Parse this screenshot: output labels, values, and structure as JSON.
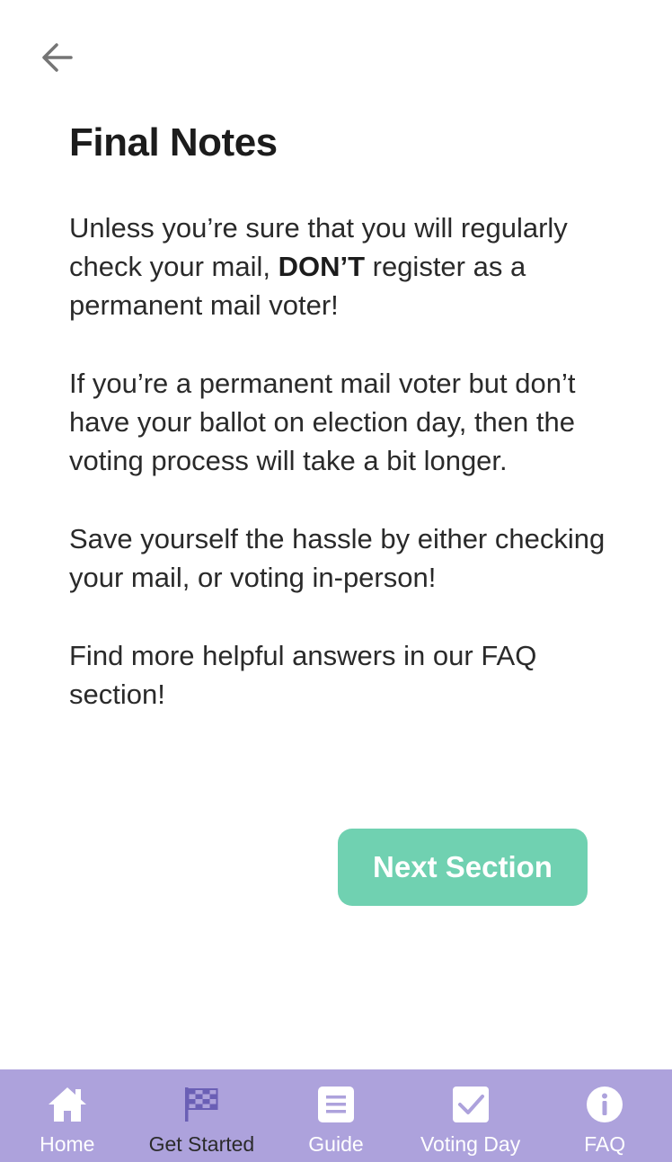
{
  "header": {
    "back_icon": "arrow-left-icon"
  },
  "content": {
    "title": "Final Notes",
    "paragraph1_before": "Unless you’re sure that you will regularly check your mail, ",
    "paragraph1_bold": "DON’T",
    "paragraph1_after": " register as a permanent mail voter!",
    "paragraph2": "If you’re a permanent mail voter but don’t have your ballot on election day, then the voting process will take a bit longer.",
    "paragraph3": "Save yourself the hassle by either checking your mail, or voting in-person!",
    "paragraph4": "Find more helpful answers in our FAQ section!"
  },
  "actions": {
    "next_label": "Next Section"
  },
  "tabbar": {
    "active": "Get Started",
    "colors": {
      "background": "#ada2dc",
      "active_icon": "#6a5fb5",
      "inactive": "#ffffff",
      "accent_button": "#70d1b1"
    },
    "items": [
      {
        "label": "Home",
        "icon": "home-icon"
      },
      {
        "label": "Get Started",
        "icon": "checkered-flag-icon"
      },
      {
        "label": "Guide",
        "icon": "list-icon"
      },
      {
        "label": "Voting Day",
        "icon": "checkbox-icon"
      },
      {
        "label": "FAQ",
        "icon": "info-icon"
      }
    ]
  }
}
